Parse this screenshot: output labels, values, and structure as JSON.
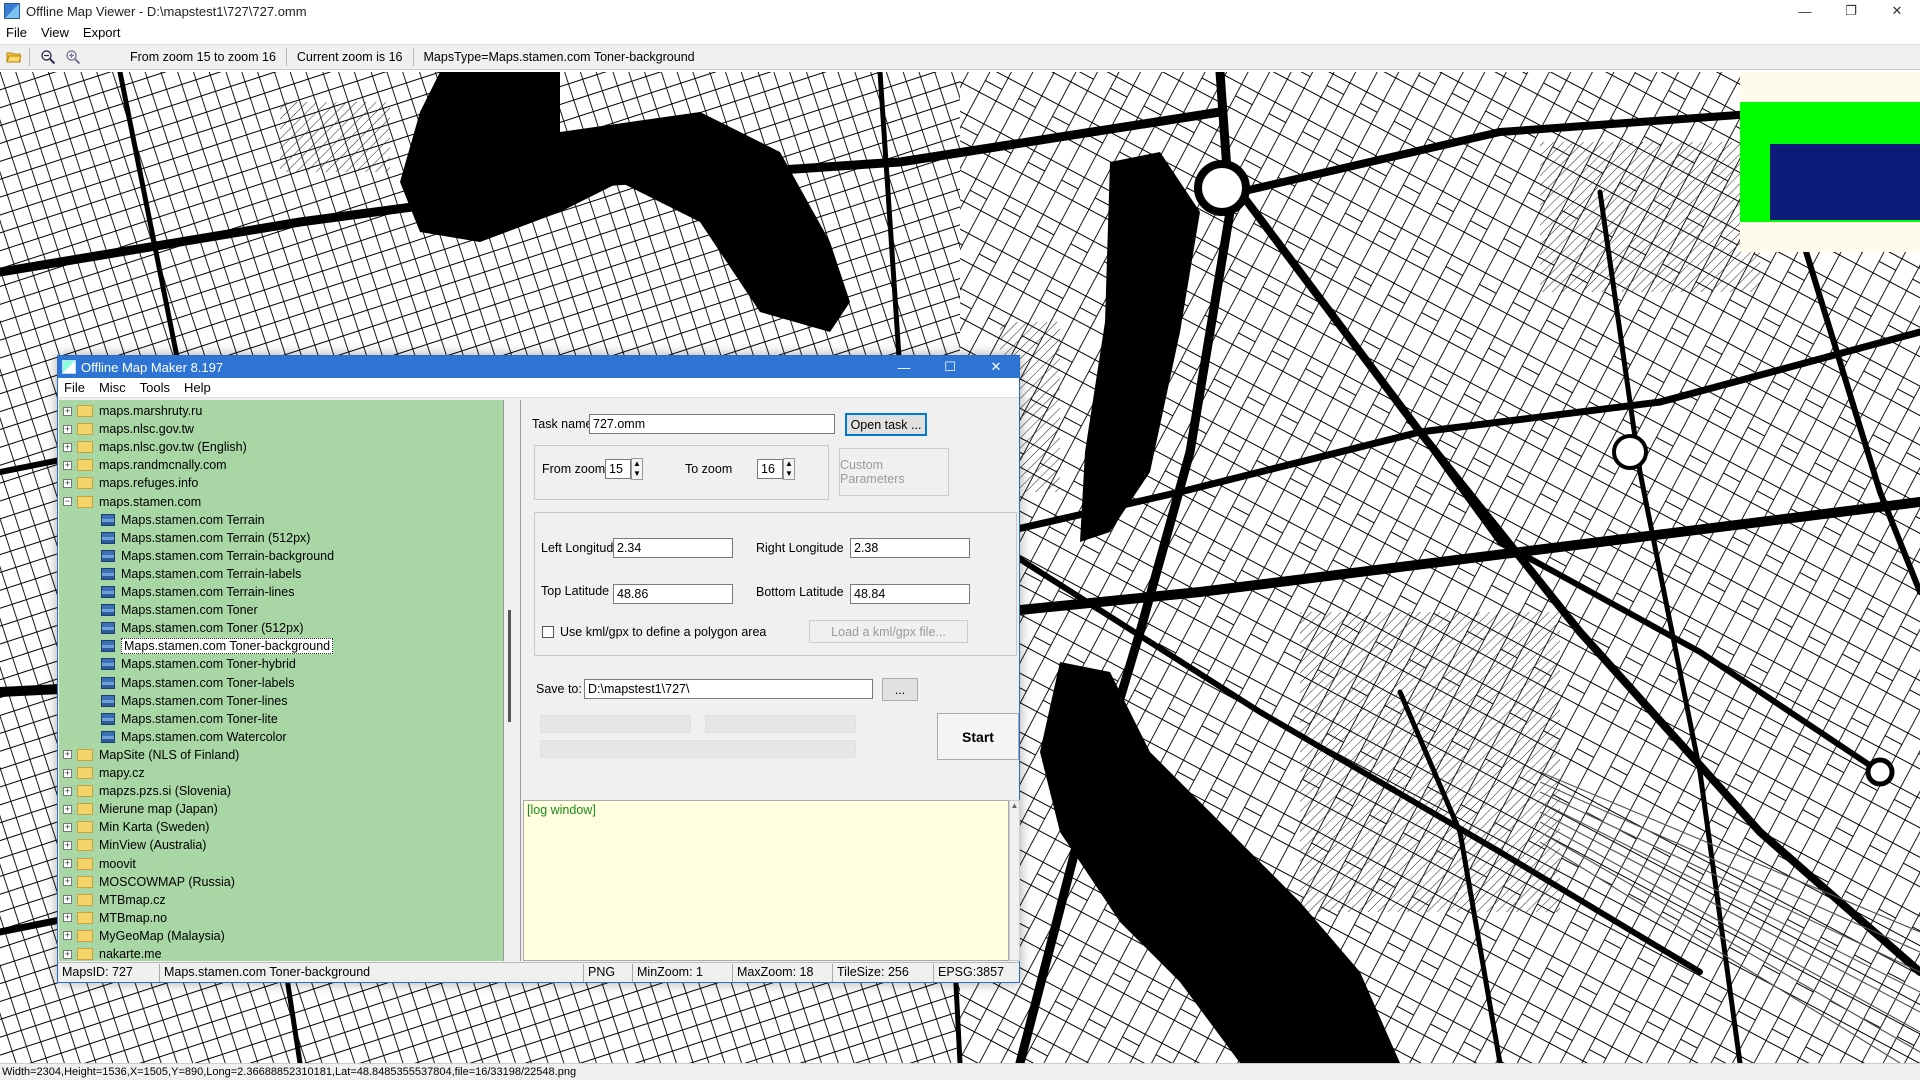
{
  "window": {
    "title": "Offline Map Viewer - D:\\mapstest1\\727\\727.omm",
    "menu": [
      "File",
      "View",
      "Export"
    ],
    "controls": {
      "minimize": "—",
      "restore": "❐",
      "close": "✕"
    }
  },
  "toolbar": {
    "zoom_range": "From zoom 15 to zoom 16",
    "current_zoom": "Current zoom is 16",
    "maps_type": "MapsType=Maps.stamen.com Toner-background",
    "icons": [
      "open-folder-icon",
      "zoom-out-icon",
      "zoom-in-icon"
    ]
  },
  "statusbar": {
    "text": "Width=2304,Height=1536,X=1505,Y=890,Long=2.36688852310181,Lat=48.8485355537804,file=16/33198/22548.png"
  },
  "dialog": {
    "title": "Offline Map Maker 8.197",
    "menu": [
      "File",
      "Misc",
      "Tools",
      "Help"
    ],
    "controls": {
      "minimize": "—",
      "maximize": "☐",
      "close": "✕"
    },
    "tree": [
      {
        "label": "maps.marshruty.ru",
        "type": "folder",
        "exp": "+"
      },
      {
        "label": "maps.nlsc.gov.tw",
        "type": "folder",
        "exp": "+"
      },
      {
        "label": "maps.nlsc.gov.tw (English)",
        "type": "folder",
        "exp": "+"
      },
      {
        "label": "maps.randmcnally.com",
        "type": "folder",
        "exp": "+"
      },
      {
        "label": "maps.refuges.info",
        "type": "folder",
        "exp": "+"
      },
      {
        "label": "maps.stamen.com",
        "type": "folder-open",
        "exp": "−"
      },
      {
        "label": "Maps.stamen.com Terrain",
        "type": "map"
      },
      {
        "label": "Maps.stamen.com Terrain (512px)",
        "type": "map"
      },
      {
        "label": "Maps.stamen.com Terrain-background",
        "type": "map"
      },
      {
        "label": "Maps.stamen.com Terrain-labels",
        "type": "map"
      },
      {
        "label": "Maps.stamen.com Terrain-lines",
        "type": "map"
      },
      {
        "label": "Maps.stamen.com Toner",
        "type": "map"
      },
      {
        "label": "Maps.stamen.com Toner (512px)",
        "type": "map"
      },
      {
        "label": "Maps.stamen.com Toner-background",
        "type": "map",
        "selected": true
      },
      {
        "label": "Maps.stamen.com Toner-hybrid",
        "type": "map"
      },
      {
        "label": "Maps.stamen.com Toner-labels",
        "type": "map"
      },
      {
        "label": "Maps.stamen.com Toner-lines",
        "type": "map"
      },
      {
        "label": "Maps.stamen.com Toner-lite",
        "type": "map"
      },
      {
        "label": "Maps.stamen.com Watercolor",
        "type": "map"
      },
      {
        "label": "MapSite (NLS of Finland)",
        "type": "folder",
        "exp": "+"
      },
      {
        "label": "mapy.cz",
        "type": "folder",
        "exp": "+"
      },
      {
        "label": "mapzs.pzs.si (Slovenia)",
        "type": "folder",
        "exp": "+"
      },
      {
        "label": "Mierune map (Japan)",
        "type": "folder",
        "exp": "+"
      },
      {
        "label": "Min Karta (Sweden)",
        "type": "folder",
        "exp": "+"
      },
      {
        "label": "MinView (Australia)",
        "type": "folder",
        "exp": "+"
      },
      {
        "label": "moovit",
        "type": "folder",
        "exp": "+"
      },
      {
        "label": "MOSCOWMAP (Russia)",
        "type": "folder",
        "exp": "+"
      },
      {
        "label": "MTBmap.cz",
        "type": "folder",
        "exp": "+"
      },
      {
        "label": "MTBmap.no",
        "type": "folder",
        "exp": "+"
      },
      {
        "label": "MyGeoMap (Malaysia)",
        "type": "folder",
        "exp": "+"
      },
      {
        "label": "nakarte.me",
        "type": "folder",
        "exp": "+"
      }
    ],
    "task": {
      "label": "Task name",
      "value": "727.omm",
      "open_button": "Open task ..."
    },
    "zoom": {
      "from_label": "From zoom",
      "from_value": "15",
      "to_label": "To zoom",
      "to_value": "16",
      "custom_button": "Custom Parameters"
    },
    "bounds": {
      "left_label": "Left Longitude",
      "left_value": "2.34",
      "right_label": "Right Longitude",
      "right_value": "2.38",
      "top_label": "Top Latitude",
      "top_value": "48.86",
      "bottom_label": "Bottom Latitude",
      "bottom_value": "48.84",
      "kml_label": "Use kml/gpx to define a polygon area",
      "kml_button": "Load a kml/gpx file..."
    },
    "save": {
      "label": "Save to:",
      "value": "D:\\mapstest1\\727\\",
      "browse_button": "..."
    },
    "start_button": "Start",
    "log_text": "[log window]",
    "status": {
      "maps_id": "MapsID: 727",
      "map_name": "Maps.stamen.com Toner-background",
      "format": "PNG",
      "min_zoom": "MinZoom: 1",
      "max_zoom": "MaxZoom: 18",
      "tile_size": "TileSize: 256",
      "epsg": "EPSG:3857"
    }
  }
}
